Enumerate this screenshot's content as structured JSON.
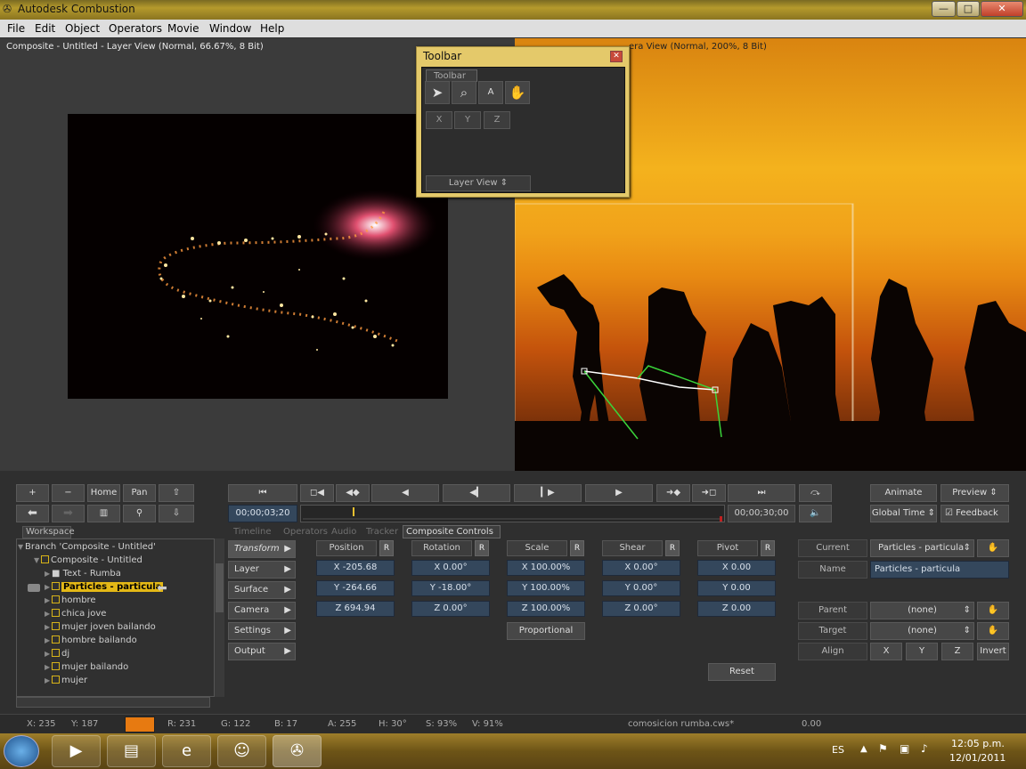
{
  "window": {
    "title": "Autodesk Combustion",
    "min": "—",
    "max": "□",
    "close": "✕"
  },
  "menu": [
    "File",
    "Edit",
    "Object",
    "Operators",
    "Movie",
    "Window",
    "Help"
  ],
  "left_view": {
    "title": "Composite - Untitled - Layer View (Normal, 66.67%, 8 Bit)"
  },
  "right_view": {
    "title": "era View (Normal, 200%, 8 Bit)"
  },
  "toolbar_window": {
    "title": "Toolbar",
    "tab": "Toolbar",
    "tools": [
      "arrow-icon",
      "magnifier-icon",
      "text-tool-icon",
      "hand-icon"
    ],
    "axes": [
      "X",
      "Y",
      "Z"
    ],
    "view_select": "Layer View"
  },
  "nav_buttons": {
    "plus": "+",
    "minus": "−",
    "home": "Home",
    "pan": "Pan"
  },
  "transport": {
    "timecode": "00;00;03;20",
    "end_time": "00;00;30;00"
  },
  "right_buttons": {
    "animate": "Animate",
    "preview": "Preview",
    "global_time": "Global Time",
    "feedback": "Feedback"
  },
  "tabs": [
    "Workspace",
    "Timeline",
    "Operators",
    "Audio",
    "Tracker",
    "Composite Controls"
  ],
  "tree": [
    {
      "label": "Branch 'Composite - Untitled'"
    },
    {
      "label": "Composite - Untitled"
    },
    {
      "label": "Text - Rumba"
    },
    {
      "label": "Particles - particula"
    },
    {
      "label": "hombre"
    },
    {
      "label": "chica jove"
    },
    {
      "label": "mujer joven bailando"
    },
    {
      "label": "hombre bailando"
    },
    {
      "label": "dj"
    },
    {
      "label": "mujer bailando"
    },
    {
      "label": "mujer"
    }
  ],
  "categories": [
    "Transform",
    "Layer",
    "Surface",
    "Camera",
    "Settings",
    "Output"
  ],
  "columns": [
    {
      "header": "Position",
      "r": "R",
      "values": [
        "X -205.68",
        "Y -264.66",
        "Z 694.94"
      ]
    },
    {
      "header": "Rotation",
      "r": "R",
      "values": [
        "X 0.00°",
        "Y -18.00°",
        "Z 0.00°"
      ]
    },
    {
      "header": "Scale",
      "r": "R",
      "values": [
        "X 100.00%",
        "Y 100.00%",
        "Z 100.00%"
      ]
    },
    {
      "header": "Shear",
      "r": "R",
      "values": [
        "X 0.00°",
        "Y 0.00°",
        "Z 0.00°"
      ]
    },
    {
      "header": "Pivot",
      "r": "R",
      "values": [
        "X 0.00",
        "Y 0.00",
        "Z 0.00"
      ]
    }
  ],
  "proportional": "Proportional",
  "reset": "Reset",
  "props": {
    "current_label": "Current",
    "current_value": "Particles - particula",
    "name_label": "Name",
    "name_value": "Particles - particula",
    "parent_label": "Parent",
    "parent_value": "(none)",
    "target_label": "Target",
    "target_value": "(none)",
    "align_label": "Align",
    "align_x": "X",
    "align_y": "Y",
    "align_z": "Z",
    "invert": "Invert"
  },
  "status": {
    "x": "X:  235",
    "y": "Y:  187",
    "r": "R: 231",
    "g": "G: 122",
    "b": "B: 17",
    "a": "A: 255",
    "h": "H: 30°",
    "s": "S: 93%",
    "v": "V: 91%",
    "file": "comosicion rumba.cws*",
    "value": "0.00",
    "swatch": "#e77a11"
  },
  "taskbar": {
    "lang": "ES",
    "time": "12:05 p.m.",
    "date": "12/01/2011"
  }
}
